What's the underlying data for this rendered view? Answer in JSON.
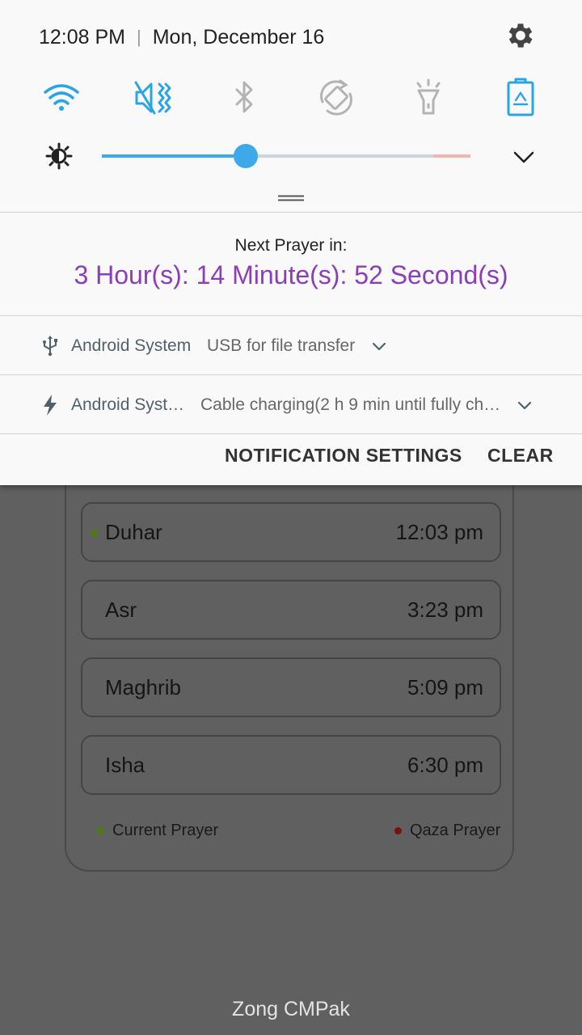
{
  "status_bar": {
    "time": "12:08 PM",
    "separator": "|",
    "date": "Mon, December 16"
  },
  "quick_settings": {
    "tiles": [
      {
        "icon": "wifi-icon",
        "active": true
      },
      {
        "icon": "sound-vibrate-icon",
        "active": true
      },
      {
        "icon": "bluetooth-icon",
        "active": false
      },
      {
        "icon": "auto-rotate-icon",
        "active": false
      },
      {
        "icon": "flashlight-icon",
        "active": false
      },
      {
        "icon": "power-saving-icon",
        "active": true
      }
    ],
    "brightness_level": 0.39,
    "accent_color": "#3ea9e8"
  },
  "prayer_notification": {
    "label": "Next Prayer in:",
    "countdown": "3 Hour(s): 14 Minute(s): 52 Second(s)",
    "accent_color": "#8a3fb7"
  },
  "notifications": [
    {
      "icon": "usb-icon",
      "app": "Android System",
      "message": "USB for file transfer"
    },
    {
      "icon": "charging-bolt-icon",
      "app": "Android Syst…",
      "message": "Cable charging(2 h 9 min until fully ch…"
    }
  ],
  "actions": {
    "settings": "NOTIFICATION SETTINGS",
    "clear": "CLEAR"
  },
  "app": {
    "prayers": [
      {
        "name": "Duhar",
        "time": "12:03 pm",
        "current": true
      },
      {
        "name": "Asr",
        "time": "3:23 pm",
        "current": false
      },
      {
        "name": "Maghrib",
        "time": "5:09 pm",
        "current": false
      },
      {
        "name": "Isha",
        "time": "6:30 pm",
        "current": false
      }
    ],
    "legend": {
      "current": "Current Prayer",
      "current_color": "#4d7a12",
      "qaza": "Qaza Prayer",
      "qaza_color": "#7a1010"
    }
  },
  "carrier": "Zong CMPak"
}
